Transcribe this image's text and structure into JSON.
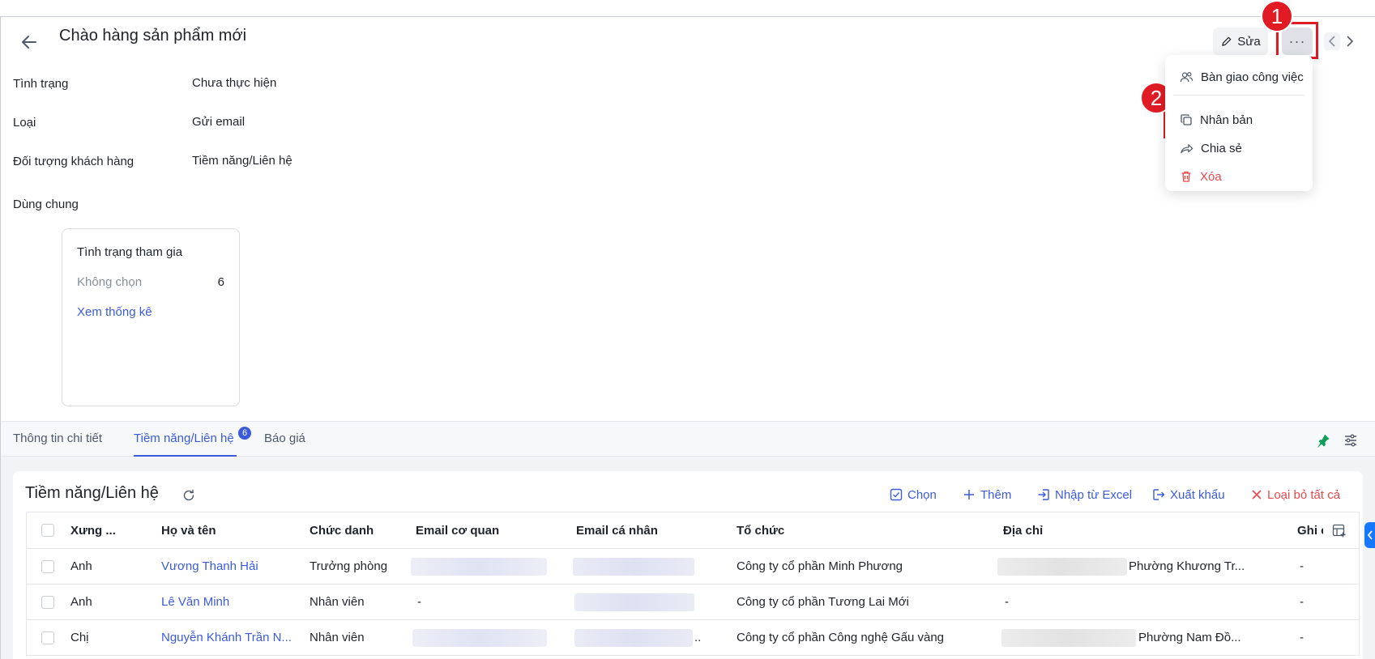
{
  "header": {
    "title": "Chào hàng sản phẩm mới",
    "edit_label": "Sửa",
    "more_label": "···"
  },
  "annotations": {
    "step1": "1",
    "step2": "2"
  },
  "fields": [
    {
      "label": "Tình trạng",
      "value": "Chưa thực hiện"
    },
    {
      "label": "Loại",
      "value": "Gửi email"
    },
    {
      "label": "Đối tượng khách hàng",
      "value": "Tiềm năng/Liên hệ"
    },
    {
      "label": "Dùng chung",
      "value": ""
    }
  ],
  "stat_card": {
    "title": "Tình trạng tham gia",
    "row_label": "Không chọn",
    "row_count": "6",
    "link": "Xem thống kê"
  },
  "menu": {
    "items": [
      {
        "label": "Bàn giao công việc",
        "icon": "handover-users-icon"
      },
      {
        "label": "Nhân bản",
        "icon": "duplicate-icon"
      },
      {
        "label": "Chia sẻ",
        "icon": "share-icon"
      },
      {
        "label": "Xóa",
        "icon": "trash-icon",
        "color": "#e5484d"
      }
    ]
  },
  "tabs": {
    "items": [
      {
        "label": "Thông tin chi tiết"
      },
      {
        "label": "Tiềm năng/Liên hệ",
        "badge": "6"
      },
      {
        "label": "Báo giá"
      }
    ]
  },
  "section": {
    "title": "Tiềm năng/Liên hệ",
    "actions": [
      {
        "label": "Chọn",
        "icon": "checkbox-icon"
      },
      {
        "label": "Thêm",
        "icon": "plus-icon"
      },
      {
        "label": "Nhập từ Excel",
        "icon": "import-icon"
      },
      {
        "label": "Xuất khẩu",
        "icon": "export-icon"
      },
      {
        "label": "Loại bỏ tất cả",
        "icon": "close-icon",
        "color": "#e5484d"
      }
    ]
  },
  "table": {
    "columns": [
      "Xưng ...",
      "Họ và tên",
      "Chức danh",
      "Email cơ quan",
      "Email cá nhân",
      "Tổ chức",
      "Địa chỉ",
      "Ghi c"
    ],
    "rows": [
      {
        "salutation": "Anh",
        "name": "Vương Thanh Hải",
        "title": "Trưởng phòng",
        "work_email": "",
        "personal_email": "",
        "org": "Công ty cổ phần Minh Phương",
        "address": "Phường Khương Tr...",
        "note": "-"
      },
      {
        "salutation": "Anh",
        "name": "Lê Văn Minh",
        "title": "Nhân viên",
        "work_email": "-",
        "personal_email": "",
        "org": "Công ty cổ phần Tương Lai Mới",
        "address": "-",
        "note": "-"
      },
      {
        "salutation": "Chị",
        "name": "Nguyễn Khánh Trần N...",
        "title": "Nhân viên",
        "work_email": "",
        "personal_email": "..",
        "org": "Công ty cổ phần Công nghệ Gấu vàng",
        "address": "Phường Nam Đồ...",
        "note": "-"
      }
    ]
  },
  "colors": {
    "accent": "#3b5bdb",
    "danger": "#e5484d",
    "highlight": "#e01b24"
  }
}
